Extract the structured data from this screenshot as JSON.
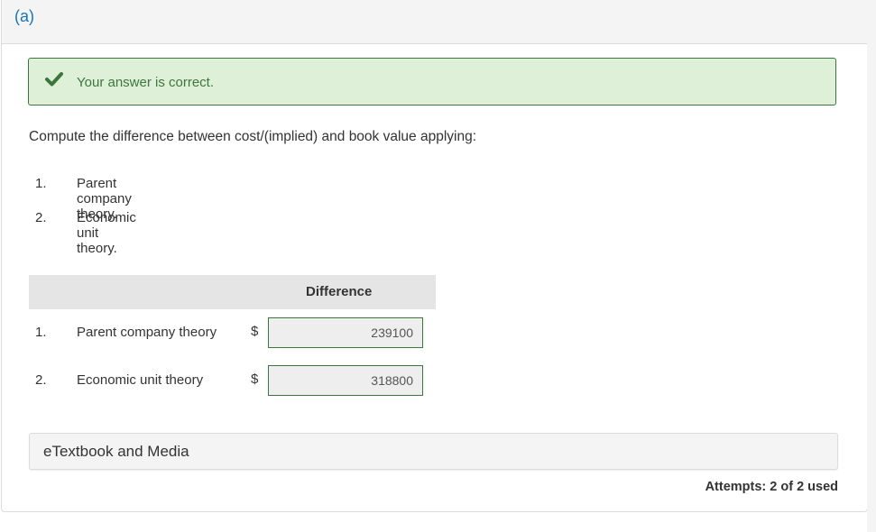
{
  "part": {
    "label": "(a)"
  },
  "feedback": {
    "message": "Your answer is correct.",
    "status": "correct",
    "color": "#3c763d",
    "background": "#dff0d8"
  },
  "question": {
    "instructions": "Compute the difference between cost/(implied) and book value applying:",
    "items": [
      {
        "number": "1.",
        "text": "Parent company theory."
      },
      {
        "number": "2.",
        "text": "Economic unit theory."
      }
    ]
  },
  "answer_table": {
    "column_header": "Difference",
    "rows": [
      {
        "number": "1.",
        "label": "Parent company theory",
        "currency": "$",
        "value": "239100"
      },
      {
        "number": "2.",
        "label": "Economic unit theory",
        "currency": "$",
        "value": "318800"
      }
    ]
  },
  "resources": {
    "label": "eTextbook and Media"
  },
  "attempts": {
    "text": "Attempts: 2 of 2 used"
  }
}
